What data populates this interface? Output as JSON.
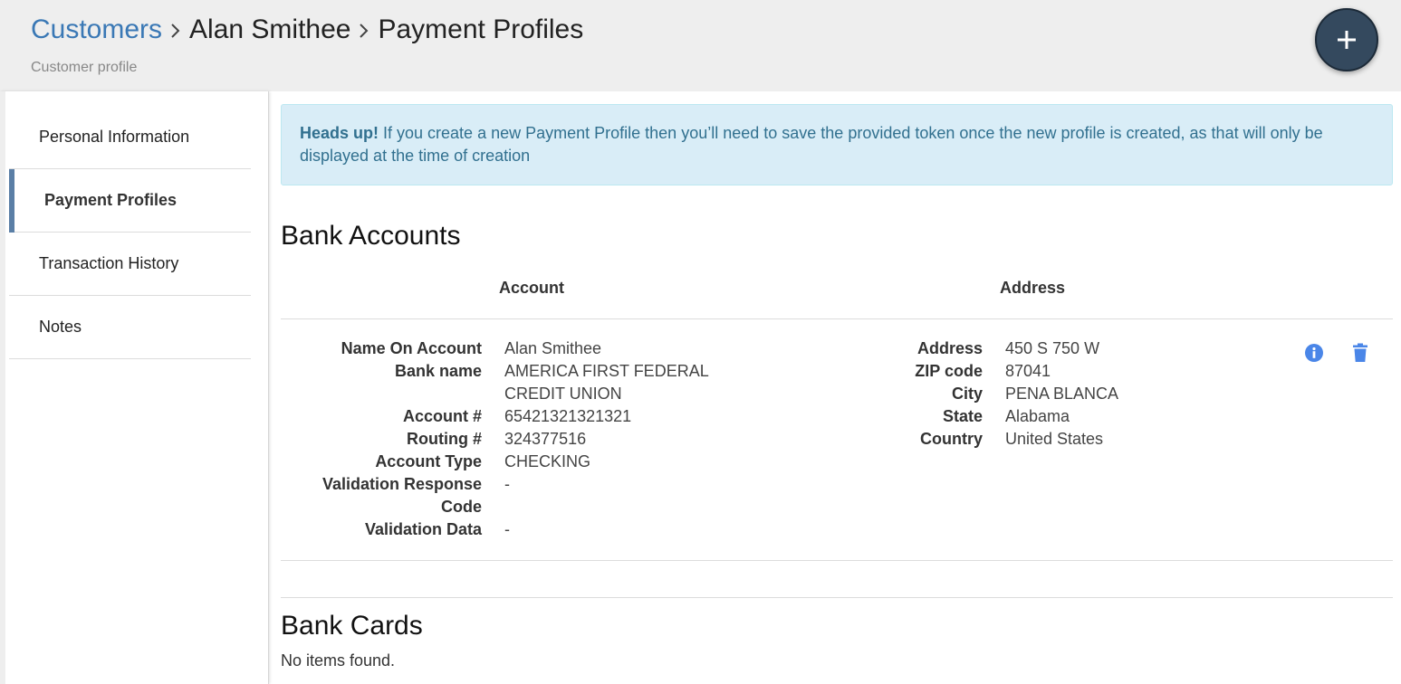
{
  "header": {
    "breadcrumb": [
      "Customers",
      "Alan Smithee",
      "Payment Profiles"
    ],
    "subtitle": "Customer profile",
    "add_button_label": "+"
  },
  "sidebar": {
    "items": [
      {
        "label": "Personal Information",
        "active": false
      },
      {
        "label": "Payment Profiles",
        "active": true
      },
      {
        "label": "Transaction History",
        "active": false
      },
      {
        "label": "Notes",
        "active": false
      }
    ]
  },
  "alert": {
    "strong": "Heads up!",
    "text": " If you create a new Payment Profile then you’ll need to save the provided token once the new profile is created, as that will only be displayed at the time of creation"
  },
  "bank_accounts": {
    "title": "Bank Accounts",
    "columns": [
      "Account",
      "Address"
    ],
    "rows": [
      {
        "account": [
          {
            "label": "Name On Account",
            "value": "Alan Smithee"
          },
          {
            "label": "Bank name",
            "value": "AMERICA FIRST FEDERAL CREDIT UNION"
          },
          {
            "label": "Account #",
            "value": "65421321321321"
          },
          {
            "label": "Routing #",
            "value": "324377516"
          },
          {
            "label": "Account Type",
            "value": "CHECKING"
          },
          {
            "label": "Validation Response Code",
            "value": "-"
          },
          {
            "label": "Validation Data",
            "value": "-"
          }
        ],
        "address": [
          {
            "label": "Address",
            "value": "450 S 750 W"
          },
          {
            "label": "ZIP code",
            "value": "87041"
          },
          {
            "label": "City",
            "value": "PENA BLANCA"
          },
          {
            "label": "State",
            "value": "Alabama"
          },
          {
            "label": "Country",
            "value": "United States"
          }
        ]
      }
    ]
  },
  "bank_cards": {
    "title": "Bank Cards",
    "empty_text": "No items found."
  },
  "icons": {
    "info": "info-icon",
    "delete": "trash-icon",
    "separator": "chevron-right-icon",
    "add": "plus-icon"
  },
  "colors": {
    "link": "#3a78b5",
    "fab": "#34495e",
    "alert_bg": "#d9edf7",
    "alert_text": "#31708f",
    "icon_blue": "#4a86e8",
    "active_indicator": "#5b7fa6"
  }
}
